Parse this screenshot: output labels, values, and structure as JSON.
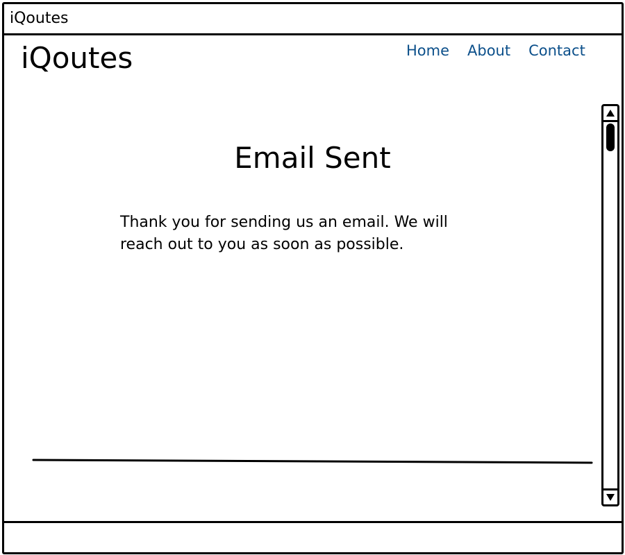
{
  "window": {
    "title": "iQoutes"
  },
  "header": {
    "logo": "iQoutes",
    "nav": [
      {
        "label": "Home"
      },
      {
        "label": "About"
      },
      {
        "label": "Contact"
      }
    ],
    "link_color": "#0b4f8a"
  },
  "main": {
    "heading": "Email Sent",
    "message": "Thank you for sending us an email. We will reach out to you as soon as possible."
  },
  "icons": {
    "scroll_up": "triangle-up-icon",
    "scroll_down": "triangle-down-icon"
  }
}
